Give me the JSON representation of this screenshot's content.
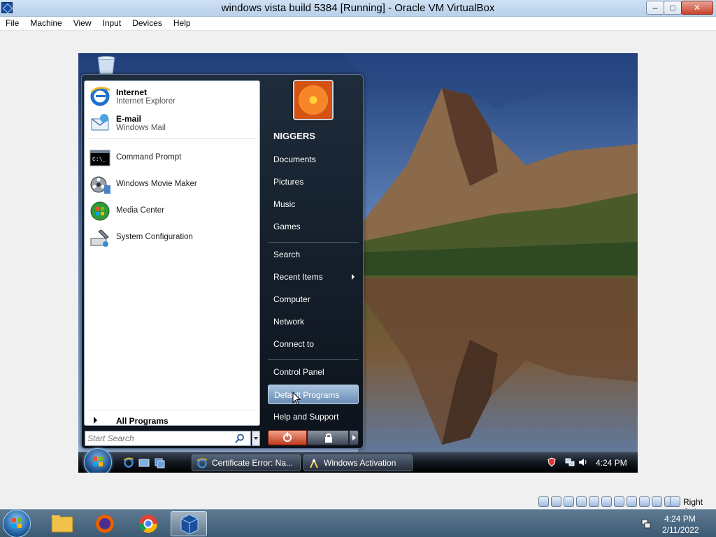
{
  "host_window": {
    "title": "windows vista build 5384 [Running] - Oracle VM VirtualBox",
    "controls": {
      "minimize": "–",
      "maximize": "□",
      "close": "✕"
    },
    "menu": [
      "File",
      "Machine",
      "View",
      "Input",
      "Devices",
      "Help"
    ]
  },
  "start_menu": {
    "pinned": [
      {
        "title": "Internet",
        "subtitle": "Internet Explorer",
        "icon": "internet-explorer-icon"
      },
      {
        "title": "E-mail",
        "subtitle": "Windows Mail",
        "icon": "windows-mail-icon"
      }
    ],
    "programs": [
      {
        "label": "Command Prompt",
        "icon": "command-prompt-icon"
      },
      {
        "label": "Windows Movie Maker",
        "icon": "movie-maker-icon"
      },
      {
        "label": "Media Center",
        "icon": "media-center-icon"
      },
      {
        "label": "System Configuration",
        "icon": "system-configuration-icon"
      }
    ],
    "all_programs": "All Programs",
    "search_placeholder": "Start Search",
    "user_name": "NIGGERS",
    "right_items": [
      "Documents",
      "Pictures",
      "Music",
      "Games",
      "Search",
      "Recent Items",
      "Computer",
      "Network",
      "Connect to",
      "Control Panel",
      "Default Programs",
      "Help and Support"
    ],
    "highlighted_item": "Default Programs"
  },
  "guest_taskbar": {
    "buttons": [
      {
        "label": "Certificate Error: Na...",
        "icon": "internet-explorer-icon"
      },
      {
        "label": "Windows Activation",
        "icon": "windows-activation-icon"
      }
    ],
    "clock": "4:24 PM"
  },
  "host_status": {
    "host_key": "Right Ctrl"
  },
  "host_taskbar": {
    "apps": [
      "file-explorer-icon",
      "firefox-icon",
      "chrome-icon",
      "virtualbox-icon"
    ],
    "time": "4:24 PM",
    "date": "2/11/2022"
  },
  "colors": {
    "vista_accent": "#1e2c3b",
    "highlight": "#6a8db5",
    "close_button": "#c8432d"
  }
}
